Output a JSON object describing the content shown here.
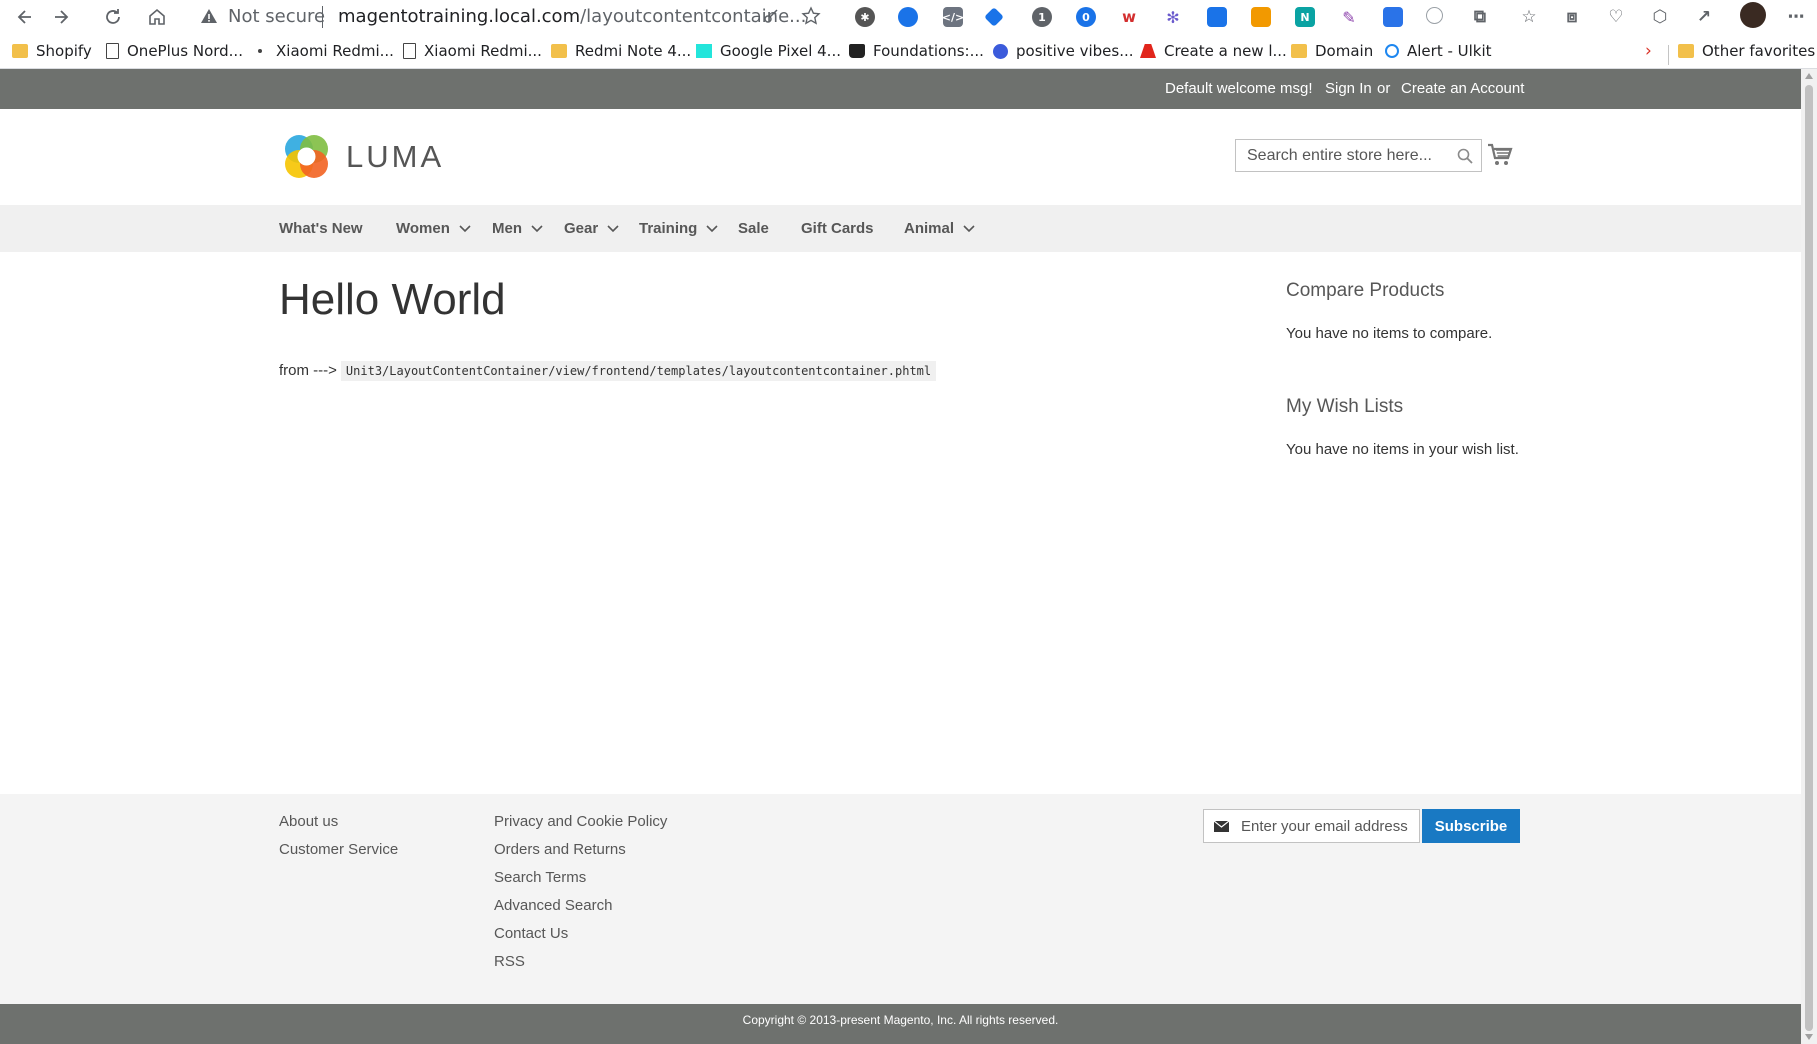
{
  "browser": {
    "security_label": "Not secure",
    "url_host": "magentotraining.local.com",
    "url_path": "/layoutcontentcontaine..."
  },
  "bookmarks": [
    {
      "label": "Shopify",
      "icon": "folder-icon"
    },
    {
      "label": "OnePlus Nord...",
      "icon": "page-icon"
    },
    {
      "label": "Xiaomi Redmi...",
      "icon": "dot-icon"
    },
    {
      "label": "Xiaomi Redmi...",
      "icon": "page-icon"
    },
    {
      "label": "Redmi Note 4...",
      "icon": "folder-icon"
    },
    {
      "label": "Google Pixel 4...",
      "icon": "olx-icon"
    },
    {
      "label": "Foundations:...",
      "icon": "shopify-bag-icon"
    },
    {
      "label": "positive vibes...",
      "icon": "c-icon"
    },
    {
      "label": "Create a new l...",
      "icon": "adobe-icon"
    },
    {
      "label": "Domain",
      "icon": "folder-icon"
    },
    {
      "label": "Alert - Ulkit",
      "icon": "uikit-icon"
    }
  ],
  "bookmarks_other": "Other favorites",
  "store": {
    "welcome": "Default welcome msg!",
    "sign_in": "Sign In",
    "or": "or",
    "create_account": "Create an Account",
    "logo_text": "LUMA",
    "search_placeholder": "Search entire store here...",
    "nav": [
      "What's New",
      "Women",
      "Men",
      "Gear",
      "Training",
      "Sale",
      "Gift Cards",
      "Animal"
    ],
    "page_title": "Hello World",
    "from_label": "from --->",
    "template_path": "Unit3/LayoutContentContainer/view/frontend/templates/layoutcontentcontainer.phtml",
    "compare_title": "Compare Products",
    "compare_text": "You have no items to compare.",
    "wishlist_title": "My Wish Lists",
    "wishlist_text": "You have no items in your wish list.",
    "footer_col1": [
      "About us",
      "Customer Service"
    ],
    "footer_col2": [
      "Privacy and Cookie Policy",
      "Orders and Returns",
      "Search Terms",
      "Advanced Search",
      "Contact Us",
      "RSS"
    ],
    "newsletter_placeholder": "Enter your email address",
    "subscribe": "Subscribe",
    "copyright": "Copyright © 2013-present Magento, Inc. All rights reserved."
  },
  "colors": {
    "header_bar": "#6e716e",
    "nav_bar": "#f0f0f0",
    "footer": "#f4f4f4",
    "subscribe_button": "#1979c3"
  }
}
